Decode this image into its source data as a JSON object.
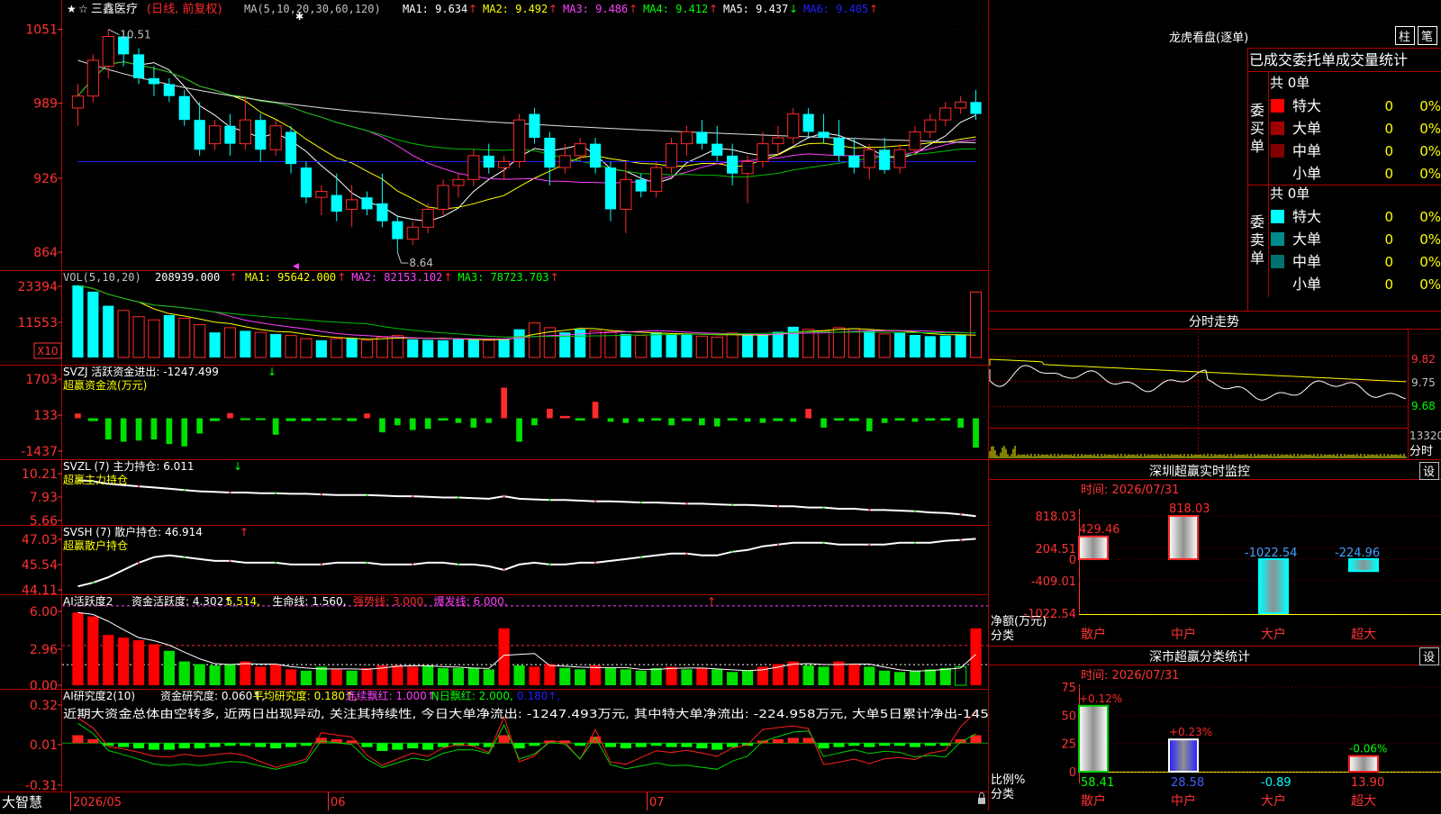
{
  "colors": {
    "up": "#ff2a2a",
    "down": "#00ffff",
    "grid": "#b00000",
    "axis": "#ff3232",
    "bg": "#000000",
    "white": "#ffffff",
    "yellow": "#ffff00",
    "magenta": "#ff40ff",
    "green": "#00c000",
    "blue": "#2020ff",
    "gray": "#c0c0c0",
    "lime": "#00ff00"
  },
  "main": {
    "stock_name": "三鑫医疗",
    "period": "(日线, 前复权)",
    "ma_params": "MA(5,10,20,30,60,120)",
    "ma_values": [
      {
        "label": "MA1: 9.634",
        "arrow": "↑",
        "color": "#ffffff"
      },
      {
        "label": "MA2: 9.492",
        "arrow": "↑",
        "color": "#ffff00"
      },
      {
        "label": "MA3: 9.486",
        "arrow": "↑",
        "color": "#ff40ff"
      },
      {
        "label": "MA4: 9.412",
        "arrow": "↑",
        "color": "#00ff00"
      },
      {
        "label": "MA5: 9.437",
        "arrow": "↓",
        "color": "#ffffff"
      },
      {
        "label": "MA6: 9.405",
        "arrow": "↑",
        "color": "#2020ff"
      }
    ],
    "y_ticks": [
      "1051",
      "989",
      "926",
      "864"
    ],
    "high_label": "10.51",
    "low_label": "8.64"
  },
  "vol": {
    "title": "VOL(5,10,20)",
    "value": "208939.000",
    "ma_values": [
      {
        "label": "MA1: 95642.000",
        "arrow": "↑",
        "color": "#ffff00"
      },
      {
        "label": "MA2: 82153.102",
        "arrow": "↑",
        "color": "#ff40ff"
      },
      {
        "label": "MA3: 78723.703",
        "arrow": "↑",
        "color": "#00ff00"
      }
    ],
    "y_ticks": [
      "23394",
      "11553"
    ],
    "unit": "X10"
  },
  "svzj": {
    "title": "SVZJ  活跃资金进出: -1247.499",
    "arrow": "↓",
    "subtitle": "超赢资金流(万元)",
    "y_ticks": [
      "1703",
      "133",
      "-1437"
    ]
  },
  "svzl": {
    "title": "SVZL (7) 主力持仓: 6.011",
    "arrow": "↓",
    "subtitle": "超赢主力持仓",
    "y_ticks": [
      "10.21",
      "7.93",
      "5.66"
    ]
  },
  "svsh": {
    "title": "SVSH (7) 散户持仓: 46.914",
    "arrow": "↑",
    "subtitle": "超赢散户持仓",
    "y_ticks": [
      "47.03",
      "45.54",
      "44.11"
    ]
  },
  "ai1": {
    "title": "AI活跃度2",
    "items": [
      {
        "label": "资金活跃度: 4.302",
        "arrow": "↑",
        "color": "#ffffff"
      },
      {
        "label": "5.514",
        "arrow": "",
        "color": "#ffff00"
      },
      {
        "label": "生命线: 1.560",
        "arrow": "",
        "color": "#ffffff"
      },
      {
        "label": "强势线: 3.000",
        "arrow": "",
        "color": "#ff2a2a"
      },
      {
        "label": "爆发线: 6.000",
        "arrow": "",
        "color": "#ff40ff"
      }
    ],
    "y_ticks": [
      "6.00",
      "2.96",
      "0.00"
    ]
  },
  "ai2": {
    "title": "AI研究度2(10)",
    "items": [
      {
        "label": "资金研究度: 0.060",
        "arrow": "↑",
        "color": "#ffffff"
      },
      {
        "label": "平均研究度: 0.180",
        "arrow": "↑",
        "color": "#ffff00"
      },
      {
        "label": "连续飘红: 1.000",
        "arrow": "↑",
        "color": "#ff40ff"
      },
      {
        "label": "N日飘红: 2.000",
        "arrow": "",
        "color": "#00ff00"
      },
      {
        "label": "0.180",
        "arrow": "↑",
        "color": "#2020ff"
      }
    ],
    "comment": "近期大资金总体由空转多, 近两日出现异动, 关注其持续性, 今日大单净流出: -1247.493万元, 其中特大单净流出: -224.958万元, 大单5日累计净出-145",
    "y_ticks": [
      "0.32",
      "0.01",
      "-0.31"
    ]
  },
  "bottom": {
    "brand": "大智慧",
    "date_labels": [
      "2026/05",
      "06",
      "07"
    ]
  },
  "lhb": {
    "title": "龙虎看盘(逐单)",
    "btn1": "柱",
    "btn2": "笔",
    "tabs": "已成交委托单成交量统计",
    "buy": {
      "label": "委买单",
      "total": "共 0单",
      "rows": [
        {
          "name": "特大",
          "val": "0",
          "pct": "0%",
          "color": "#ff0000"
        },
        {
          "name": "大单",
          "val": "0",
          "pct": "0%",
          "color": "#a00000"
        },
        {
          "name": "中单",
          "val": "0",
          "pct": "0%",
          "color": "#800000"
        },
        {
          "name": "小单",
          "val": "0",
          "pct": "0%",
          "color": ""
        }
      ]
    },
    "sell": {
      "label": "委卖单",
      "total": "共 0单",
      "rows": [
        {
          "name": "特大",
          "val": "0",
          "pct": "0%",
          "color": "#00ffff"
        },
        {
          "name": "大单",
          "val": "0",
          "pct": "0%",
          "color": "#008c8c"
        },
        {
          "name": "中单",
          "val": "0",
          "pct": "0%",
          "color": "#007070"
        },
        {
          "name": "小单",
          "val": "0",
          "pct": "0%",
          "color": ""
        }
      ]
    }
  },
  "intraday": {
    "title": "分时走势",
    "y_ticks": [
      "9.82",
      "9.75",
      "9.68"
    ],
    "vol_tick": "13320",
    "vol_label": "分时"
  },
  "monitor": {
    "title": "深圳超赢实时监控",
    "btn": "设",
    "time": "时间: 2026/07/31",
    "y_ticks": [
      "818.03",
      "204.51",
      "0",
      "-409.01",
      "-1022.54"
    ],
    "unit_label": "净额(万元)",
    "cat_label": "分类",
    "categories": [
      "散户",
      "中户",
      "大户",
      "超大"
    ],
    "values": [
      429.46,
      818.03,
      -1022.54,
      -224.96
    ],
    "value_labels": [
      "429.46",
      "818.03",
      "-1022.54",
      "-224.96"
    ]
  },
  "classify": {
    "title": "深市超赢分类统计",
    "btn": "设",
    "time": "时间: 2026/07/31",
    "y_ticks": [
      "75",
      "50",
      "25",
      "0"
    ],
    "unit_label": "比例%",
    "cat_label": "分类",
    "categories": [
      "散户",
      "中户",
      "大户",
      "超大"
    ],
    "values": [
      58.41,
      28.58,
      -0.89,
      13.9
    ],
    "value_labels": [
      "58.41",
      "28.58",
      "-0.89",
      "13.90"
    ],
    "change_labels": [
      "+0.12%",
      "+0.23%",
      "",
      "-0.06%"
    ]
  },
  "chart_data": [
    {
      "type": "candlestick",
      "title": "三鑫医疗 (日线, 前复权)",
      "ylim": [
        8.55,
        10.62
      ],
      "x_labels": [
        "2026/05",
        "06",
        "07"
      ],
      "ohlc": [
        [
          9.85,
          10.05,
          9.7,
          9.95
        ],
        [
          9.95,
          10.3,
          9.9,
          10.25
        ],
        [
          10.2,
          10.51,
          10.1,
          10.45
        ],
        [
          10.45,
          10.5,
          10.2,
          10.3
        ],
        [
          10.3,
          10.35,
          10.05,
          10.1
        ],
        [
          10.1,
          10.2,
          9.95,
          10.05
        ],
        [
          10.05,
          10.1,
          9.9,
          9.95
        ],
        [
          9.95,
          10.0,
          9.7,
          9.75
        ],
        [
          9.75,
          9.9,
          9.45,
          9.5
        ],
        [
          9.55,
          9.75,
          9.5,
          9.7
        ],
        [
          9.7,
          9.8,
          9.45,
          9.55
        ],
        [
          9.55,
          9.95,
          9.5,
          9.75
        ],
        [
          9.75,
          9.8,
          9.4,
          9.5
        ],
        [
          9.5,
          9.75,
          9.45,
          9.7
        ],
        [
          9.65,
          9.7,
          9.3,
          9.38
        ],
        [
          9.35,
          9.4,
          9.05,
          9.1
        ],
        [
          9.1,
          9.2,
          8.95,
          9.15
        ],
        [
          9.12,
          9.3,
          8.9,
          8.98
        ],
        [
          9.0,
          9.2,
          8.85,
          9.08
        ],
        [
          9.1,
          9.15,
          8.95,
          9.0
        ],
        [
          9.05,
          9.3,
          8.85,
          8.9
        ],
        [
          8.9,
          8.95,
          8.64,
          8.75
        ],
        [
          8.75,
          8.9,
          8.7,
          8.85
        ],
        [
          8.85,
          9.05,
          8.8,
          9.0
        ],
        [
          9.0,
          9.25,
          8.95,
          9.2
        ],
        [
          9.2,
          9.3,
          9.1,
          9.25
        ],
        [
          9.25,
          9.5,
          9.2,
          9.45
        ],
        [
          9.45,
          9.55,
          9.3,
          9.35
        ],
        [
          9.35,
          9.45,
          9.25,
          9.4
        ],
        [
          9.4,
          9.8,
          9.35,
          9.75
        ],
        [
          9.8,
          9.85,
          9.55,
          9.6
        ],
        [
          9.6,
          9.65,
          9.2,
          9.35
        ],
        [
          9.35,
          9.55,
          9.3,
          9.45
        ],
        [
          9.45,
          9.6,
          9.4,
          9.55
        ],
        [
          9.55,
          9.6,
          9.3,
          9.35
        ],
        [
          9.35,
          9.4,
          8.9,
          9.0
        ],
        [
          9.0,
          9.4,
          8.8,
          9.25
        ],
        [
          9.25,
          9.3,
          9.1,
          9.15
        ],
        [
          9.15,
          9.4,
          9.1,
          9.35
        ],
        [
          9.35,
          9.6,
          9.3,
          9.55
        ],
        [
          9.55,
          9.7,
          9.45,
          9.65
        ],
        [
          9.65,
          9.75,
          9.5,
          9.55
        ],
        [
          9.55,
          9.7,
          9.4,
          9.45
        ],
        [
          9.45,
          9.55,
          9.2,
          9.3
        ],
        [
          9.3,
          9.45,
          9.05,
          9.4
        ],
        [
          9.4,
          9.65,
          9.35,
          9.55
        ],
        [
          9.55,
          9.7,
          9.45,
          9.6
        ],
        [
          9.6,
          9.85,
          9.55,
          9.8
        ],
        [
          9.8,
          9.85,
          9.6,
          9.65
        ],
        [
          9.65,
          9.8,
          9.55,
          9.6
        ],
        [
          9.6,
          9.75,
          9.4,
          9.45
        ],
        [
          9.45,
          9.6,
          9.3,
          9.35
        ],
        [
          9.35,
          9.55,
          9.25,
          9.5
        ],
        [
          9.5,
          9.6,
          9.3,
          9.33
        ],
        [
          9.35,
          9.55,
          9.3,
          9.5
        ],
        [
          9.5,
          9.7,
          9.45,
          9.65
        ],
        [
          9.65,
          9.8,
          9.6,
          9.75
        ],
        [
          9.75,
          9.9,
          9.7,
          9.85
        ],
        [
          9.85,
          9.95,
          9.8,
          9.9
        ],
        [
          9.9,
          10.0,
          9.75,
          9.8
        ]
      ],
      "series": [
        {
          "name": "MA1",
          "color": "#ffffff"
        },
        {
          "name": "MA2",
          "color": "#ffff00"
        },
        {
          "name": "MA3",
          "color": "#ff40ff"
        },
        {
          "name": "MA4",
          "color": "#00ff00"
        },
        {
          "name": "MA5",
          "color": "#ffffff"
        },
        {
          "name": "MA6",
          "color": "#2020ff"
        }
      ]
    },
    {
      "type": "bar",
      "title": "VOL(5,10,20)",
      "ylim": [
        0,
        27000
      ],
      "values": [
        23000,
        21000,
        16500,
        15000,
        13000,
        12000,
        13500,
        12500,
        10500,
        8000,
        9500,
        8500,
        8000,
        7500,
        7000,
        6000,
        5500,
        6000,
        6200,
        5500,
        6500,
        7000,
        5800,
        5600,
        5500,
        6000,
        5700,
        5500,
        5800,
        9000,
        11000,
        9500,
        8000,
        9000,
        8500,
        8200,
        7500,
        7000,
        8000,
        7500,
        7600,
        6800,
        6500,
        7800,
        7200,
        7400,
        8200,
        9800,
        9000,
        8500,
        9500,
        9200,
        8600,
        7500,
        8000,
        7200,
        6800,
        7000,
        7300,
        20893
      ],
      "up": [
        1,
        1,
        1,
        0,
        0,
        0,
        1,
        0,
        0,
        1,
        0,
        1,
        0,
        1,
        0,
        0,
        1,
        0,
        1,
        0,
        0,
        0,
        1,
        1,
        1,
        1,
        1,
        0,
        1,
        1,
        0,
        0,
        1,
        1,
        0,
        0,
        1,
        0,
        1,
        1,
        1,
        0,
        0,
        0,
        1,
        1,
        1,
        1,
        0,
        0,
        0,
        0,
        1,
        0,
        1,
        1,
        1,
        1,
        1,
        0
      ]
    },
    {
      "type": "bar",
      "title": "SVZJ 活跃资金进出",
      "ylim": [
        -1437,
        1703
      ],
      "values": [
        200,
        -120,
        -900,
        -1000,
        -950,
        -900,
        -1100,
        -1200,
        -650,
        -120,
        220,
        -80,
        -80,
        -700,
        -120,
        -120,
        -100,
        -80,
        -120,
        200,
        -600,
        -300,
        -500,
        -450,
        -100,
        -200,
        -400,
        -200,
        1300,
        -1000,
        -300,
        400,
        100,
        -100,
        700,
        -150,
        -200,
        -150,
        -100,
        -300,
        -120,
        -300,
        -350,
        -100,
        -150,
        -200,
        -120,
        -150,
        400,
        -400,
        -100,
        -120,
        -550,
        -200,
        -100,
        -150,
        -100,
        -100,
        -400,
        -1247
      ]
    },
    {
      "type": "line",
      "title": "SVZL 主力持仓",
      "ylim": [
        5.66,
        10.21
      ],
      "values": [
        8.9,
        8.8,
        8.6,
        8.5,
        8.4,
        8.3,
        8.2,
        8.1,
        8.0,
        7.95,
        7.9,
        7.9,
        7.85,
        7.85,
        7.8,
        7.8,
        7.75,
        7.7,
        7.7,
        7.7,
        7.65,
        7.6,
        7.6,
        7.55,
        7.5,
        7.5,
        7.45,
        7.4,
        7.6,
        7.4,
        7.35,
        7.3,
        7.3,
        7.25,
        7.2,
        7.2,
        7.15,
        7.1,
        7.1,
        7.05,
        7.0,
        7.0,
        6.95,
        6.9,
        6.9,
        6.85,
        6.8,
        6.8,
        6.7,
        6.7,
        6.6,
        6.6,
        6.5,
        6.5,
        6.45,
        6.4,
        6.3,
        6.25,
        6.15,
        6.01
      ]
    },
    {
      "type": "line",
      "title": "SVSH 散户持仓",
      "ylim": [
        44.11,
        47.03
      ],
      "values": [
        44.3,
        44.5,
        44.8,
        45.2,
        45.6,
        45.9,
        46.0,
        45.9,
        45.8,
        45.7,
        45.7,
        45.6,
        45.6,
        45.6,
        45.5,
        45.5,
        45.5,
        45.6,
        45.6,
        45.6,
        45.5,
        45.5,
        45.5,
        45.6,
        45.6,
        45.5,
        45.5,
        45.4,
        45.2,
        45.5,
        45.6,
        45.5,
        45.5,
        45.6,
        45.6,
        45.7,
        45.8,
        45.9,
        46.0,
        46.1,
        46.1,
        46.0,
        46.0,
        46.2,
        46.3,
        46.5,
        46.6,
        46.7,
        46.7,
        46.7,
        46.6,
        46.6,
        46.6,
        46.6,
        46.7,
        46.7,
        46.7,
        46.8,
        46.85,
        46.91
      ]
    },
    {
      "type": "bar",
      "title": "AI活跃度2",
      "ylim": [
        0,
        6.6
      ],
      "values": [
        5.5,
        5.2,
        3.8,
        3.6,
        3.4,
        3.1,
        2.6,
        1.8,
        1.6,
        1.5,
        1.6,
        1.8,
        1.4,
        1.6,
        1.2,
        1.1,
        1.4,
        1.2,
        1.1,
        1.3,
        1.5,
        1.5,
        1.4,
        1.5,
        1.3,
        1.3,
        1.3,
        1.2,
        4.3,
        1.5,
        1.4,
        1.6,
        1.3,
        1.2,
        1.5,
        1.3,
        1.2,
        1.1,
        1.3,
        1.4,
        1.2,
        1.3,
        1.2,
        1.0,
        1.1,
        1.4,
        1.6,
        1.8,
        1.5,
        1.4,
        1.8,
        1.6,
        1.4,
        1.1,
        1.0,
        1.1,
        1.2,
        1.3,
        1.4,
        4.3
      ],
      "up": [
        1,
        1,
        1,
        1,
        1,
        1,
        0,
        0,
        0,
        0,
        0,
        1,
        1,
        1,
        1,
        0,
        0,
        1,
        0,
        1,
        1,
        1,
        1,
        0,
        0,
        0,
        0,
        0,
        1,
        0,
        1,
        1,
        0,
        0,
        1,
        0,
        0,
        0,
        0,
        1,
        0,
        1,
        0,
        0,
        0,
        1,
        1,
        1,
        0,
        0,
        1,
        1,
        0,
        0,
        0,
        0,
        0,
        0,
        0,
        1
      ]
    },
    {
      "type": "bar",
      "title": "AI研究度2(10)",
      "ylim": [
        -0.31,
        0.32
      ],
      "values": [
        0.06,
        0.03,
        -0.02,
        -0.03,
        -0.04,
        -0.05,
        -0.05,
        -0.04,
        -0.04,
        -0.03,
        -0.02,
        -0.02,
        -0.03,
        -0.04,
        -0.03,
        -0.02,
        0.04,
        0.03,
        0.02,
        -0.03,
        -0.06,
        -0.05,
        -0.04,
        -0.05,
        -0.03,
        -0.02,
        -0.02,
        -0.03,
        0.06,
        -0.04,
        -0.02,
        0.02,
        0.02,
        -0.02,
        0.05,
        -0.03,
        -0.04,
        -0.03,
        -0.02,
        -0.03,
        -0.03,
        -0.04,
        -0.05,
        -0.03,
        -0.02,
        0.02,
        0.03,
        0.04,
        0.04,
        -0.04,
        -0.03,
        -0.02,
        -0.03,
        -0.02,
        -0.02,
        -0.03,
        -0.02,
        -0.02,
        0.03,
        0.06
      ]
    },
    {
      "type": "bar",
      "title": "深圳超赢实时监控",
      "categories": [
        "散户",
        "中户",
        "大户",
        "超大"
      ],
      "values": [
        429.46,
        818.03,
        -1022.54,
        -224.96
      ],
      "ylim": [
        -1022.54,
        818.03
      ]
    },
    {
      "type": "bar",
      "title": "深市超赢分类统计",
      "categories": [
        "散户",
        "中户",
        "大户",
        "超大"
      ],
      "values": [
        58.41,
        28.58,
        -0.89,
        13.9
      ],
      "ylim": [
        0,
        75
      ]
    }
  ]
}
